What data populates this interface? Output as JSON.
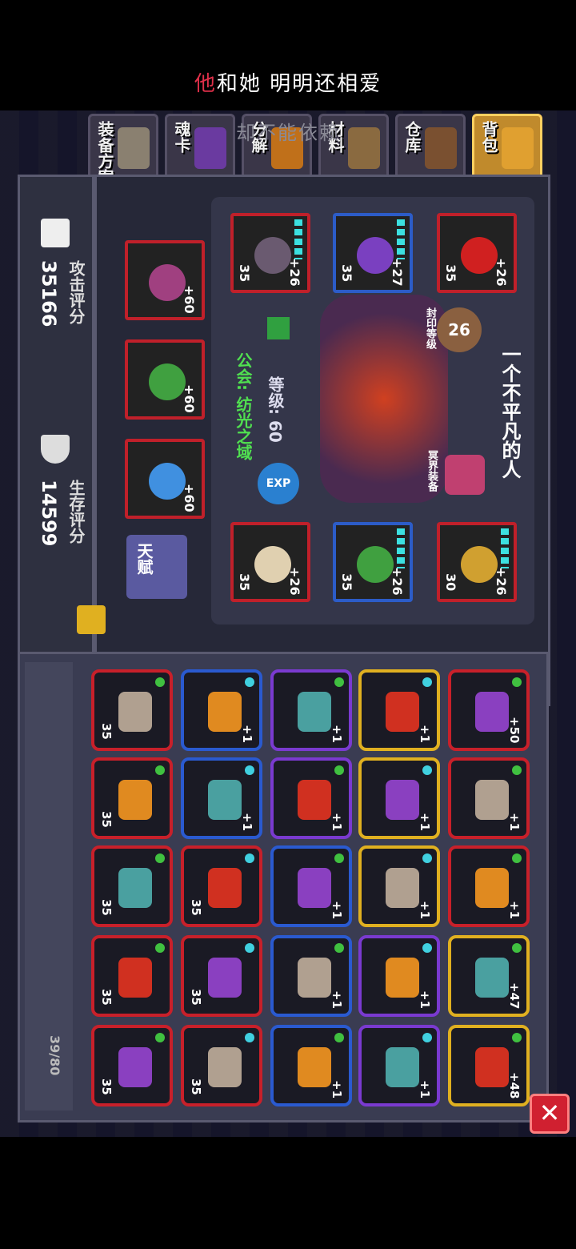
{
  "lyrics": {
    "line1_highlight": "他",
    "line1_rest": "和她 明明还相爱",
    "line2": "却不能依赖"
  },
  "tabs": [
    {
      "label": "装备方案"
    },
    {
      "label": "魂卡"
    },
    {
      "label": "分解"
    },
    {
      "label": "材料"
    },
    {
      "label": "仓库"
    },
    {
      "label": "背包"
    }
  ],
  "stats": {
    "attack_value": "35166",
    "attack_label": "攻击评分",
    "survival_value": "14599",
    "survival_label": "生存评分"
  },
  "character": {
    "name": "一个不平凡的人",
    "level_label": "等级: 60",
    "guild_label": "公会: 纺光之域",
    "seal_level": "26",
    "seal_label": "封印等级",
    "soul_label": "冥界装备",
    "exp_label": "EXP",
    "talent_label": "天赋"
  },
  "weapons": [
    {
      "plus": "+60"
    },
    {
      "plus": "+60"
    },
    {
      "plus": "+60"
    }
  ],
  "equip_top": [
    {
      "level": "35",
      "plus": "+26"
    },
    {
      "level": "35",
      "plus": "+27"
    },
    {
      "level": "35",
      "plus": "+26"
    }
  ],
  "equip_bottom": [
    {
      "level": "35",
      "plus": "+26"
    },
    {
      "level": "35",
      "plus": "+26"
    },
    {
      "level": "30",
      "plus": "+26"
    }
  ],
  "inventory": {
    "count": "39/80",
    "rows": [
      [
        {
          "lv": "35",
          "pl": ""
        },
        {
          "lv": "",
          "pl": "+1"
        },
        {
          "lv": "",
          "pl": "+1"
        },
        {
          "lv": "",
          "pl": "+1"
        },
        {
          "lv": "",
          "pl": "+50"
        }
      ],
      [
        {
          "lv": "35",
          "pl": ""
        },
        {
          "lv": "",
          "pl": "+1"
        },
        {
          "lv": "",
          "pl": "+1"
        },
        {
          "lv": "",
          "pl": "+1"
        },
        {
          "lv": "",
          "pl": "+1"
        }
      ],
      [
        {
          "lv": "35",
          "pl": ""
        },
        {
          "lv": "35",
          "pl": ""
        },
        {
          "lv": "",
          "pl": "+1"
        },
        {
          "lv": "",
          "pl": "+1"
        },
        {
          "lv": "",
          "pl": "+1"
        }
      ],
      [
        {
          "lv": "35",
          "pl": ""
        },
        {
          "lv": "35",
          "pl": ""
        },
        {
          "lv": "",
          "pl": "+1"
        },
        {
          "lv": "",
          "pl": "+1"
        },
        {
          "lv": "",
          "pl": "+47"
        }
      ],
      [
        {
          "lv": "35",
          "pl": ""
        },
        {
          "lv": "35",
          "pl": ""
        },
        {
          "lv": "",
          "pl": "+1"
        },
        {
          "lv": "",
          "pl": "+1"
        },
        {
          "lv": "",
          "pl": "+48"
        }
      ]
    ]
  },
  "close_label": "✕",
  "colors": {
    "red": "#c8202a",
    "blue": "#2a5ad0",
    "purple": "#7a3ad0",
    "gold": "#e0b020",
    "highlight": "#e0304a"
  }
}
